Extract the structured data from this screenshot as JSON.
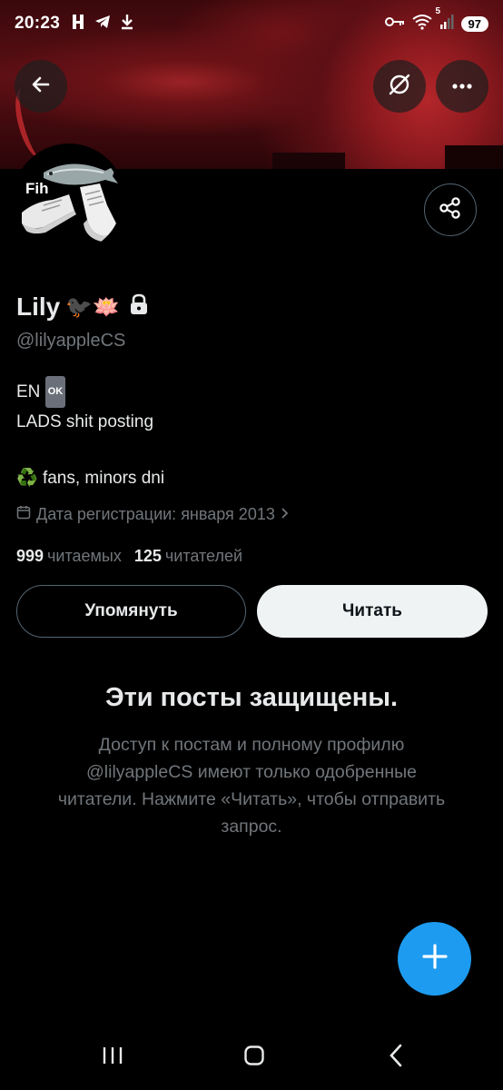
{
  "status_bar": {
    "time": "20:23",
    "battery": "97",
    "signal_label": "5"
  },
  "profile": {
    "avatar_label": "Fih",
    "display_name": "Lily",
    "name_emojis": "🐦‍⬛🪷",
    "handle": "@lilyappleCS",
    "bio": {
      "line1_prefix": "EN",
      "line1_badge": "OK",
      "line2": "LADS shit posting",
      "line3_emoji": "♻️",
      "line3": "fans, minors dni"
    },
    "joined": "Дата регистрации: января 2013",
    "following_count": "999",
    "following_label": "читаемых",
    "followers_count": "125",
    "followers_label": "читателей"
  },
  "actions": {
    "mention_label": "Упомянуть",
    "follow_label": "Читать"
  },
  "protected": {
    "title": "Эти посты защищены.",
    "text": "Доступ к постам и полному профилю @lilyappleCS имеют только одобренные читатели. Нажмите «Читать», чтобы отправить запрос."
  },
  "icons": {
    "back": "arrow-left-icon",
    "grok": "grok-icon",
    "more": "more-horizontal-icon",
    "share": "share-icon",
    "lock": "lock-icon",
    "calendar": "calendar-icon",
    "compose": "plus-icon"
  },
  "colors": {
    "accent": "#1d9bf0",
    "secondary_text": "#71767b",
    "primary_text": "#e7e9ea",
    "follow_button_bg": "#eff3f4"
  }
}
